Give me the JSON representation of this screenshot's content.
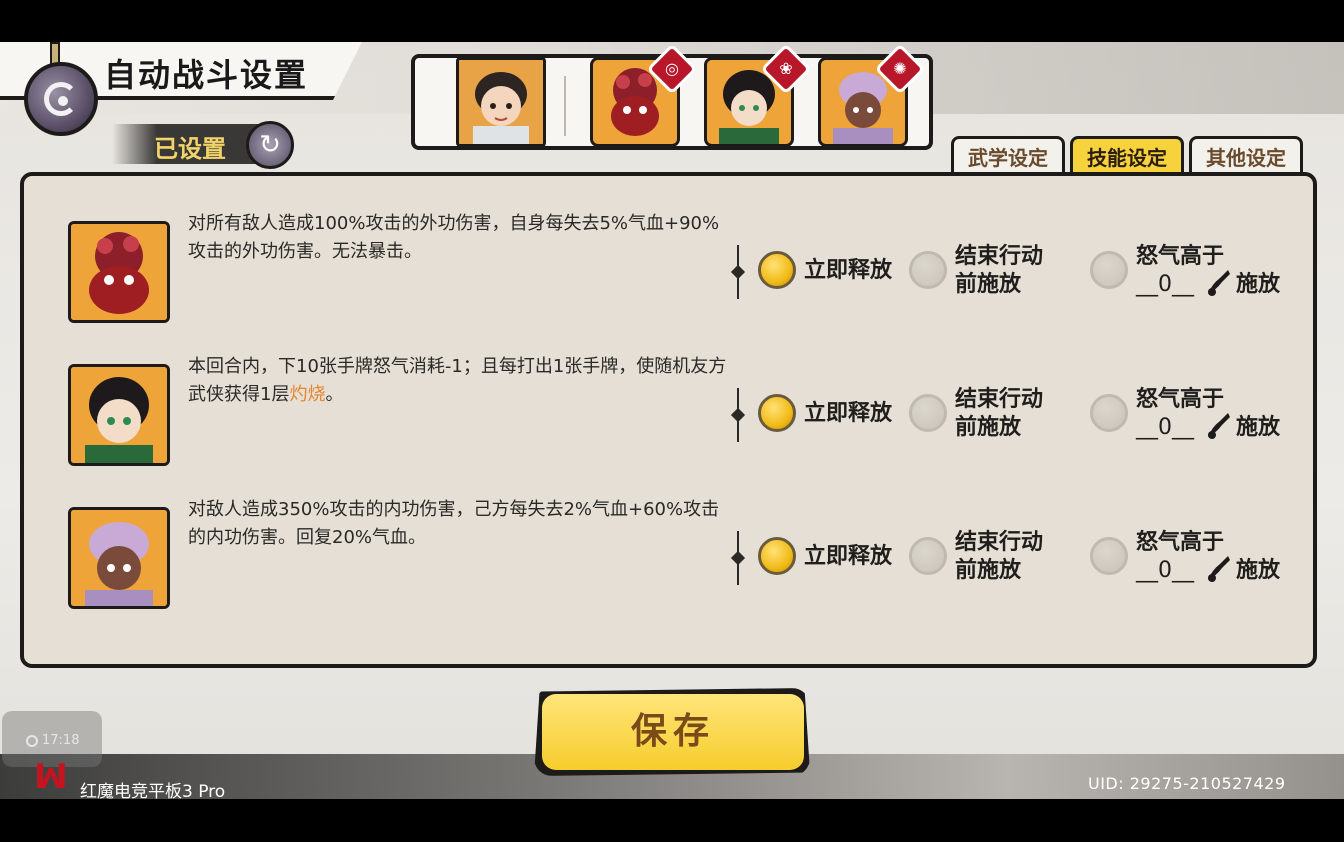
{
  "header": {
    "title": "自动战斗设置",
    "status_label": "已设置"
  },
  "tabs": [
    {
      "label": "武学设定",
      "active": false
    },
    {
      "label": "技能设定",
      "active": true
    },
    {
      "label": "其他设定",
      "active": false
    }
  ],
  "skills": [
    {
      "description_parts": [
        "对所有敌人造成100%攻击的外功伤害，自身每失去5%气血+90%攻击的外功伤害。无法暴击。",
        ""
      ],
      "highlight": "",
      "options": {
        "immediate": "立即释放",
        "end_turn": "结束行动\n前施放",
        "rage": "怒气高于",
        "rage_value": "__0__",
        "rage_suffix": "施放"
      },
      "selected": "immediate"
    },
    {
      "description_parts": [
        "本回合内，下10张手牌怒气消耗-1；且每打出1张手牌，使随机友方武侠获得1层",
        "。"
      ],
      "highlight": "灼烧",
      "options": {
        "immediate": "立即释放",
        "end_turn": "结束行动\n前施放",
        "rage": "怒气高于",
        "rage_value": "__0__",
        "rage_suffix": "施放"
      },
      "selected": "immediate"
    },
    {
      "description_parts": [
        "对敌人造成350%攻击的内功伤害，己方每失去2%气血+60%攻击的内功伤害。回复20%气血。",
        ""
      ],
      "highlight": "",
      "options": {
        "immediate": "立即释放",
        "end_turn": "结束行动\n前施放",
        "rage": "怒气高于",
        "rage_value": "__0__",
        "rage_suffix": "施放"
      },
      "selected": "immediate"
    }
  ],
  "save_button": "保存",
  "overlay": {
    "time": "17:18",
    "device": "红魔电竞平板3 Pro",
    "uid": "UID: 29275-210527429"
  },
  "colors": {
    "accent_yellow": "#f6cd2c",
    "badge_red": "#b8172a",
    "highlight": "#e8862d"
  }
}
